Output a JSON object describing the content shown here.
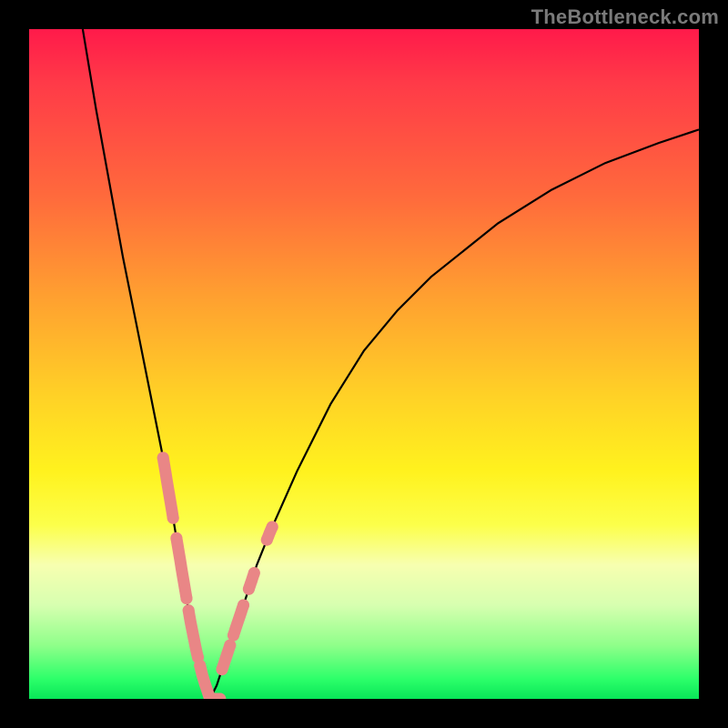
{
  "watermark": "TheBottleneck.com",
  "colors": {
    "gradient_top": "#ff1a4a",
    "gradient_bottom": "#08e658",
    "curve": "#000000",
    "marker": "#e98686",
    "frame": "#000000",
    "watermark_text": "#7a7a7a"
  },
  "chart_data": {
    "type": "line",
    "title": "",
    "xlabel": "",
    "ylabel": "",
    "xlim": [
      0,
      100
    ],
    "ylim": [
      0,
      100
    ],
    "grid": false,
    "legend": false,
    "description": "Two black curves descend from upper-left and upper-right toward a shared minimum near x≈27 at y≈0, forming a V. Pink rounded markers highlight short segments on both branches near the bottom of the V.",
    "series": [
      {
        "name": "left-branch",
        "x": [
          8,
          10,
          12,
          14,
          16,
          18,
          20,
          22,
          23,
          24,
          25,
          26,
          27
        ],
        "y": [
          100,
          88,
          77,
          66,
          56,
          46,
          36,
          24,
          18,
          12,
          7,
          3,
          0
        ]
      },
      {
        "name": "right-branch",
        "x": [
          27,
          28,
          29,
          30,
          32,
          34,
          36,
          40,
          45,
          50,
          55,
          60,
          65,
          70,
          78,
          86,
          94,
          100
        ],
        "y": [
          0,
          2,
          5,
          8,
          14,
          20,
          25,
          34,
          44,
          52,
          58,
          63,
          67,
          71,
          76,
          80,
          83,
          85
        ]
      }
    ],
    "highlight_segments": [
      {
        "branch": "left-branch",
        "x_start": 20.0,
        "x_end": 21.5
      },
      {
        "branch": "left-branch",
        "x_start": 22.0,
        "x_end": 23.5
      },
      {
        "branch": "left-branch",
        "x_start": 23.8,
        "x_end": 25.2
      },
      {
        "branch": "left-branch",
        "x_start": 25.5,
        "x_end": 28.5
      },
      {
        "branch": "right-branch",
        "x_start": 28.8,
        "x_end": 30.0
      },
      {
        "branch": "right-branch",
        "x_start": 30.5,
        "x_end": 32.0
      },
      {
        "branch": "right-branch",
        "x_start": 32.8,
        "x_end": 33.6
      },
      {
        "branch": "right-branch",
        "x_start": 35.5,
        "x_end": 36.3
      }
    ]
  }
}
